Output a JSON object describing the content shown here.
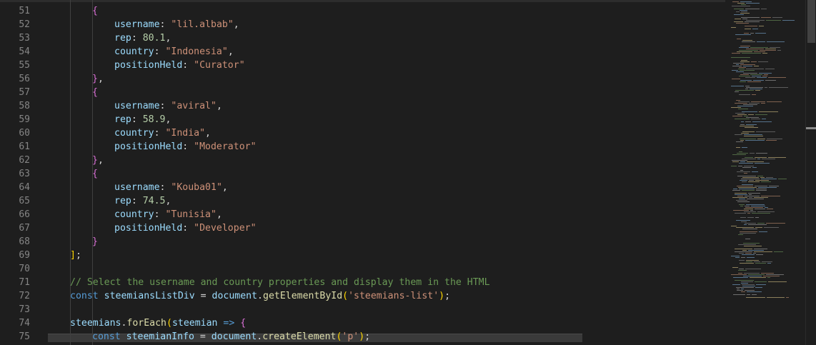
{
  "editor": {
    "lines": [
      {
        "n": "51",
        "tokens": [
          {
            "t": "{",
            "c": "b2"
          }
        ]
      },
      {
        "n": "52",
        "tokens": [
          {
            "t": "username",
            "c": "v"
          },
          {
            "t": ": ",
            "c": "p"
          },
          {
            "t": "\"lil.albab\"",
            "c": "s"
          },
          {
            "t": ",",
            "c": "p"
          }
        ]
      },
      {
        "n": "53",
        "tokens": [
          {
            "t": "rep",
            "c": "v"
          },
          {
            "t": ": ",
            "c": "p"
          },
          {
            "t": "80.1",
            "c": "n"
          },
          {
            "t": ",",
            "c": "p"
          }
        ]
      },
      {
        "n": "54",
        "tokens": [
          {
            "t": "country",
            "c": "v"
          },
          {
            "t": ": ",
            "c": "p"
          },
          {
            "t": "\"Indonesia\"",
            "c": "s"
          },
          {
            "t": ",",
            "c": "p"
          }
        ]
      },
      {
        "n": "55",
        "tokens": [
          {
            "t": "positionHeld",
            "c": "v"
          },
          {
            "t": ": ",
            "c": "p"
          },
          {
            "t": "\"Curator\"",
            "c": "s"
          }
        ]
      },
      {
        "n": "56",
        "tokens": [
          {
            "t": "}",
            "c": "b2"
          },
          {
            "t": ",",
            "c": "p"
          }
        ]
      },
      {
        "n": "57",
        "tokens": [
          {
            "t": "{",
            "c": "b2"
          }
        ]
      },
      {
        "n": "58",
        "tokens": [
          {
            "t": "username",
            "c": "v"
          },
          {
            "t": ": ",
            "c": "p"
          },
          {
            "t": "\"aviral\"",
            "c": "s"
          },
          {
            "t": ",",
            "c": "p"
          }
        ]
      },
      {
        "n": "59",
        "tokens": [
          {
            "t": "rep",
            "c": "v"
          },
          {
            "t": ": ",
            "c": "p"
          },
          {
            "t": "58.9",
            "c": "n"
          },
          {
            "t": ",",
            "c": "p"
          }
        ]
      },
      {
        "n": "60",
        "tokens": [
          {
            "t": "country",
            "c": "v"
          },
          {
            "t": ": ",
            "c": "p"
          },
          {
            "t": "\"India\"",
            "c": "s"
          },
          {
            "t": ",",
            "c": "p"
          }
        ]
      },
      {
        "n": "61",
        "tokens": [
          {
            "t": "positionHeld",
            "c": "v"
          },
          {
            "t": ": ",
            "c": "p"
          },
          {
            "t": "\"Moderator\"",
            "c": "s"
          }
        ]
      },
      {
        "n": "62",
        "tokens": [
          {
            "t": "}",
            "c": "b2"
          },
          {
            "t": ",",
            "c": "p"
          }
        ]
      },
      {
        "n": "63",
        "tokens": [
          {
            "t": "{",
            "c": "b2"
          }
        ]
      },
      {
        "n": "64",
        "tokens": [
          {
            "t": "username",
            "c": "v"
          },
          {
            "t": ": ",
            "c": "p"
          },
          {
            "t": "\"Kouba01\"",
            "c": "s"
          },
          {
            "t": ",",
            "c": "p"
          }
        ]
      },
      {
        "n": "65",
        "tokens": [
          {
            "t": "rep",
            "c": "v"
          },
          {
            "t": ": ",
            "c": "p"
          },
          {
            "t": "74.5",
            "c": "n"
          },
          {
            "t": ",",
            "c": "p"
          }
        ]
      },
      {
        "n": "66",
        "tokens": [
          {
            "t": "country",
            "c": "v"
          },
          {
            "t": ": ",
            "c": "p"
          },
          {
            "t": "\"Tunisia\"",
            "c": "s"
          },
          {
            "t": ",",
            "c": "p"
          }
        ]
      },
      {
        "n": "67",
        "tokens": [
          {
            "t": "positionHeld",
            "c": "v"
          },
          {
            "t": ": ",
            "c": "p"
          },
          {
            "t": "\"Developer\"",
            "c": "s"
          }
        ]
      },
      {
        "n": "68",
        "tokens": [
          {
            "t": "}",
            "c": "b2"
          }
        ]
      },
      {
        "n": "69",
        "tokens": [
          {
            "t": "]",
            "c": "b1"
          },
          {
            "t": ";",
            "c": "p"
          }
        ]
      },
      {
        "n": "70",
        "tokens": []
      },
      {
        "n": "71",
        "tokens": [
          {
            "t": "// Select the username and country properties and display them in the HTML",
            "c": "c"
          }
        ]
      },
      {
        "n": "72",
        "tokens": [
          {
            "t": "const ",
            "c": "k"
          },
          {
            "t": "steemiansListDiv",
            "c": "v"
          },
          {
            "t": " = ",
            "c": "p"
          },
          {
            "t": "document",
            "c": "v"
          },
          {
            "t": ".",
            "c": "p"
          },
          {
            "t": "getElementById",
            "c": "f"
          },
          {
            "t": "(",
            "c": "b1"
          },
          {
            "t": "'steemians-list'",
            "c": "s"
          },
          {
            "t": ")",
            "c": "b1"
          },
          {
            "t": ";",
            "c": "p"
          }
        ]
      },
      {
        "n": "73",
        "tokens": []
      },
      {
        "n": "74",
        "tokens": [
          {
            "t": "steemians",
            "c": "v"
          },
          {
            "t": ".",
            "c": "p"
          },
          {
            "t": "forEach",
            "c": "f"
          },
          {
            "t": "(",
            "c": "b1"
          },
          {
            "t": "steemian",
            "c": "v"
          },
          {
            "t": " => ",
            "c": "k"
          },
          {
            "t": "{",
            "c": "b2"
          }
        ]
      },
      {
        "n": "75",
        "tokens": [
          {
            "t": "const ",
            "c": "k"
          },
          {
            "t": "steemianInfo",
            "c": "v"
          },
          {
            "t": " = ",
            "c": "p"
          },
          {
            "t": "document",
            "c": "v"
          },
          {
            "t": ".",
            "c": "p"
          },
          {
            "t": "createElement",
            "c": "f"
          },
          {
            "t": "(",
            "c": "b1"
          },
          {
            "t": "'p'",
            "c": "s"
          },
          {
            "t": ")",
            "c": "b1"
          },
          {
            "t": ";",
            "c": "p"
          }
        ]
      }
    ]
  },
  "colors": {
    "background": "#1e1e1e",
    "keyword": "#569cd6",
    "variable": "#9cdcfe",
    "string": "#ce9178",
    "number": "#b5cea8",
    "function": "#dcdcaa",
    "comment": "#6a9955",
    "bracket_yellow": "#ffd700",
    "bracket_purple": "#da70d6"
  }
}
